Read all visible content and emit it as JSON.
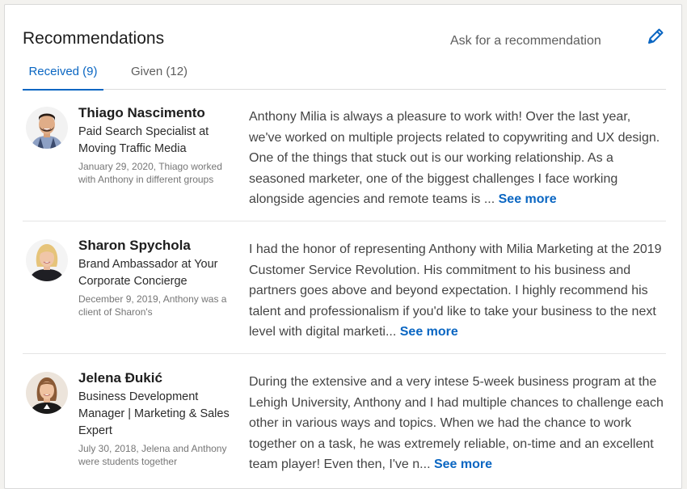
{
  "section": {
    "title": "Recommendations",
    "ask_label": "Ask for a recommendation",
    "edit_icon": "pencil-icon",
    "accent_color": "#0a66c2"
  },
  "tabs": [
    {
      "label": "Received (9)",
      "active": true
    },
    {
      "label": "Given (12)",
      "active": false
    }
  ],
  "recommendations": [
    {
      "name": "Thiago Nascimento",
      "headline": "Paid Search Specialist at Moving Traffic Media",
      "meta": "January 29, 2020, Thiago worked with Anthony in different groups",
      "text": "Anthony Milia is always a pleasure to work with! Over the last year, we've worked on multiple projects related to copywriting and UX design. One of the things that stuck out is our working relationship. As a seasoned marketer, one of the biggest challenges I face working alongside agencies and remote teams is ...",
      "see_more": "See more"
    },
    {
      "name": "Sharon Spychola",
      "headline": "Brand Ambassador at Your Corporate Concierge",
      "meta": "December 9, 2019, Anthony was a client of Sharon's",
      "text": "I had the honor of representing Anthony with Milia Marketing at the 2019 Customer Service Revolution. His commitment to his business and partners goes above and beyond expectation. I highly recommend his talent and professionalism if you'd like to take your business to the next level with digital marketi...",
      "see_more": "See more"
    },
    {
      "name": "Jelena Đukić",
      "headline": "Business Development Manager | Marketing & Sales Expert",
      "meta": "July 30, 2018, Jelena and Anthony were students together",
      "text": "During the extensive and a very intese 5-week business program at the Lehigh University, Anthony and I had multiple chances to challenge each other in various ways and topics. When we had the chance to work together on a task, he was extremely reliable, on-time and an excellent team player! Even then, I've n...",
      "see_more": "See more"
    }
  ]
}
